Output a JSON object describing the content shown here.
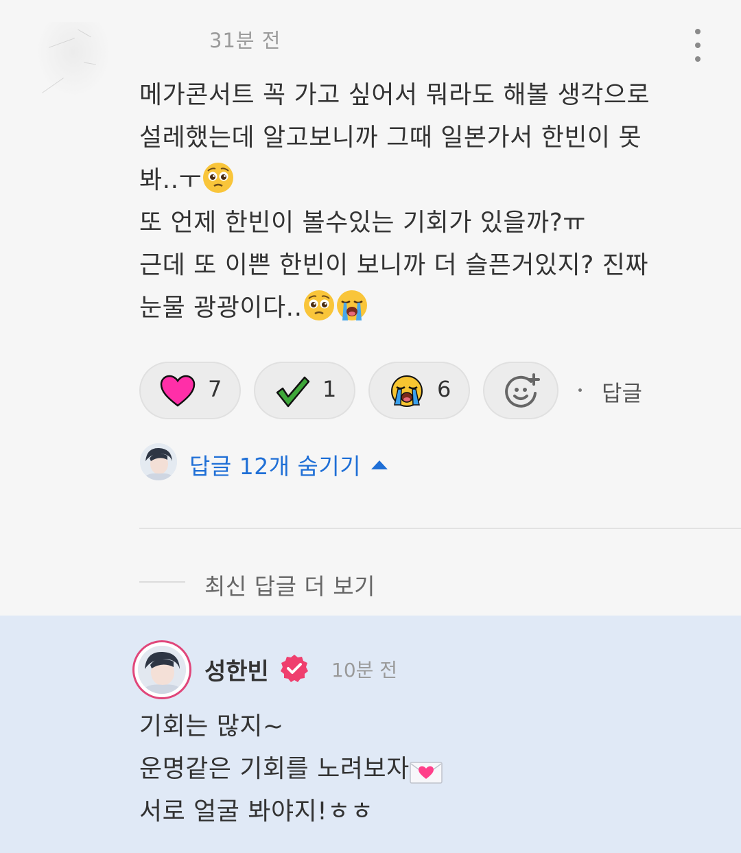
{
  "comment": {
    "time": "31분 전",
    "lines": [
      "메가콘서트 꼭 가고 싶어서 뭐라도 해볼 생각으로",
      "설레했는데 알고보니까 그때 일본가서 한빈이 못",
      "봐..ㅜ",
      "또 언제 한빈이 볼수있는 기회가 있을까?ㅠ",
      "근데 또 이쁜 한빈이 보니까 더 슬픈거있지? 진짜",
      "눈물 광광이다.."
    ],
    "reactions": [
      {
        "icon": "heart-icon",
        "count": "7",
        "color": "#ff2fa8"
      },
      {
        "icon": "check-icon",
        "count": "1",
        "color": "#2e8b2e"
      },
      {
        "icon": "crying-face-icon",
        "count": "6",
        "color": "#f7c531"
      }
    ],
    "reply_label": "답글"
  },
  "replies_toggle": {
    "label": "답글 12개 숨기기",
    "accent": "#1f6fd6"
  },
  "more_latest_label": "최신 답글 더 보기",
  "reply": {
    "author": "성한빈",
    "time": "10분 전",
    "lines": [
      "기회는 많지~",
      "운명같은 기회를 노려보자",
      "서로 얼굴 봐야지!ㅎㅎ"
    ],
    "highlight_bg": "#e0e9f6",
    "badge_color": "#ef3f6e"
  }
}
